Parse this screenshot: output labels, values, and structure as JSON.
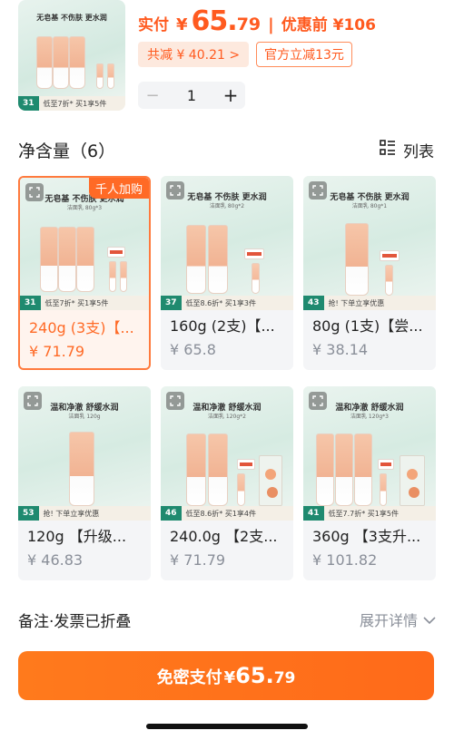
{
  "header": {
    "price_label": "实付",
    "currency": "¥",
    "price_int": "65.",
    "price_dec": "79",
    "separator": "|",
    "before_label": "优惠前 ¥106",
    "total_discount": "共减 ¥ 40.21 >",
    "official_discount": "官方立减13元",
    "hero_strip_tag": "31",
    "hero_strip_text": "低至7折* 买1享5件",
    "hero_headline": "无皂基 不伤肤 更水润"
  },
  "stepper": {
    "minus": "−",
    "qty": "1",
    "plus": "+"
  },
  "section": {
    "title": "净含量（6）",
    "view_label": "列表"
  },
  "options": [
    {
      "title": "240g (3支)【...",
      "price": "¥ 71.79",
      "badge": "千人加购",
      "headline": "无皂基 不伤肤 更水润",
      "sub": "洁面乳 80g*3",
      "strip_tag": "31",
      "strip_text": "低至7折* 买1享5件"
    },
    {
      "title": "160g (2支)【...",
      "price": "¥ 65.8",
      "headline": "无皂基 不伤肤 更水润",
      "sub": "洁面乳 80g*2",
      "strip_tag": "37",
      "strip_text": "低至8.6折* 买1享3件"
    },
    {
      "title": "80g (1支)【尝...",
      "price": "¥ 38.14",
      "headline": "无皂基 不伤肤 更水润",
      "sub": "洁面乳 80g*1",
      "strip_tag": "43",
      "strip_text": "抢! 下单立享优惠"
    },
    {
      "title": "120g 【升级...",
      "price": "¥ 46.83",
      "headline": "温和净澈 舒缓水润",
      "sub": "洁面乳 120g",
      "strip_tag": "53",
      "strip_text": "抢! 下单立享优惠"
    },
    {
      "title": "240.0g 【2支...",
      "price": "¥ 71.79",
      "headline": "温和净澈 舒缓水润",
      "sub": "洁面乳 120g*2",
      "strip_tag": "46",
      "strip_text": "低至8.6折* 买1享4件"
    },
    {
      "title": "360g 【3支升...",
      "price": "¥ 101.82",
      "headline": "温和净澈 舒缓水润",
      "sub": "洁面乳 120g*3",
      "strip_tag": "41",
      "strip_text": "低至7.7折* 买1享5件"
    }
  ],
  "footer": {
    "note_label": "备注·发票已折叠",
    "expand_label": "展开详情",
    "pay_label": "免密支付",
    "pay_yen": "¥",
    "pay_int": "65.",
    "pay_dec": "79"
  },
  "colors": {
    "accent": "#ff6a26",
    "price_gray": "#8a8f99",
    "tag_green": "#1f8a6f"
  }
}
